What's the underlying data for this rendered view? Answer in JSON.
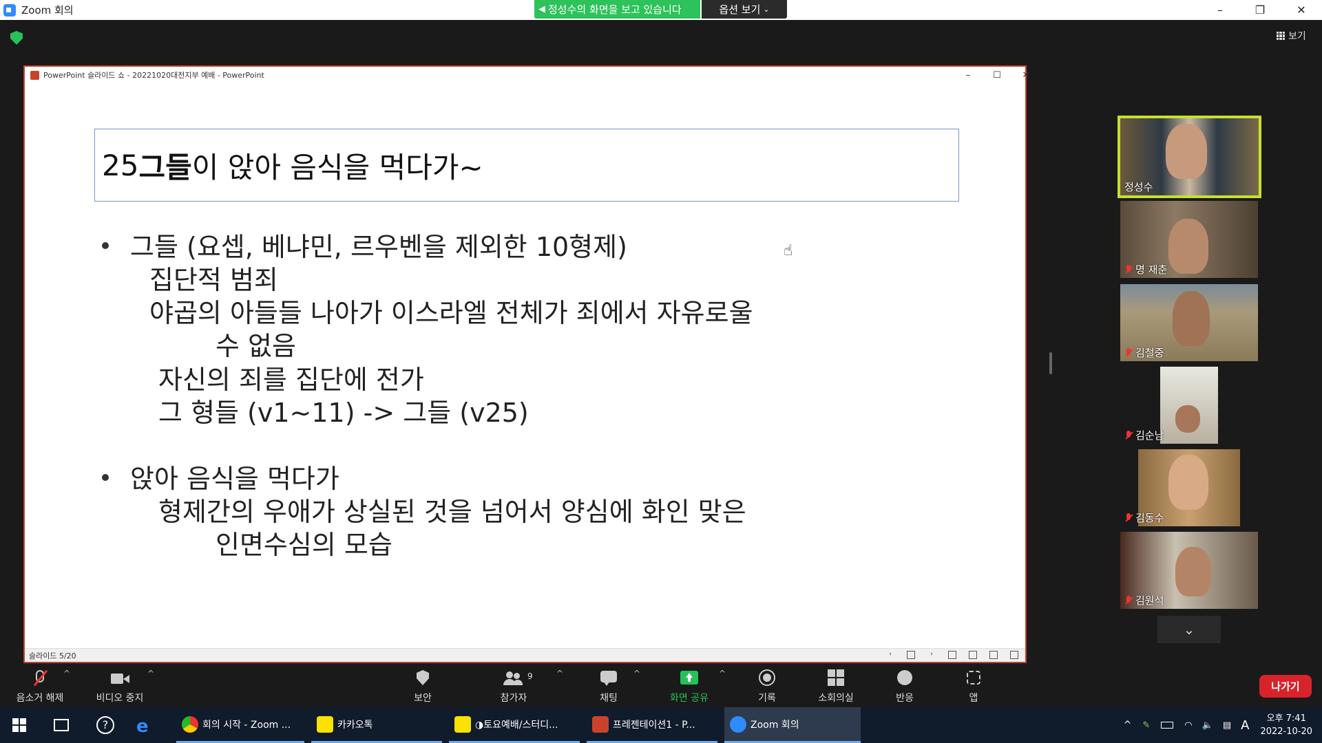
{
  "window": {
    "title": "Zoom 회의",
    "share_banner": "정성수의 화면을 보고 있습니다",
    "view_options": "옵션 보기",
    "view_button": "보기"
  },
  "powerpoint": {
    "window_title": "PowerPoint 슬라이드 쇼  -  20221020대전지부 예배 - PowerPoint",
    "slide_indicator": "슬라이드 5/20",
    "slide": {
      "title_number": "25 ",
      "title_bold": "그들",
      "title_rest": "이 앉아 음식을 먹다가~",
      "lines": [
        "그들 (요셉, 베냐민, 르우벤을 제외한 10형제)",
        "집단적 범죄",
        "야곱의 아들들 나아가 이스라엘 전체가 죄에서 자유로울",
        "수 없음",
        "자신의 죄를 집단에 전가",
        "그 형들 (v1~11) -> 그들 (v25)",
        "앉아 음식을 먹다가",
        "형제간의 우애가 상실된 것을 넘어서 양심에 화인 맞은",
        "인면수심의 모습"
      ]
    }
  },
  "participants": [
    {
      "name": "정성수",
      "muted": false,
      "active": true
    },
    {
      "name": "명 재춘",
      "muted": true
    },
    {
      "name": "김철중",
      "muted": true
    },
    {
      "name": "김순남",
      "muted": true
    },
    {
      "name": "김동수",
      "muted": true
    },
    {
      "name": "김원석",
      "muted": true
    }
  ],
  "toolbar": {
    "unmute": "음소거 해제",
    "stop_video": "비디오 중지",
    "security": "보안",
    "participants": "참가자",
    "participants_count": "9",
    "chat": "채팅",
    "share_screen": "화면 공유",
    "record": "기록",
    "breakout": "소회의실",
    "reactions": "반응",
    "apps": "앱",
    "leave": "나가기"
  },
  "taskbar": {
    "items": [
      {
        "label": "회의 시작 - Zoom ...",
        "icon": "chrome-icon"
      },
      {
        "label": "카카오톡",
        "icon": "kakaotalk-icon"
      },
      {
        "label": "◑토요예배/스터디...",
        "icon": "kakaotalk-icon"
      },
      {
        "label": "프레젠테이션1 - P...",
        "icon": "powerpoint-icon"
      },
      {
        "label": "Zoom 회의",
        "icon": "zoom-icon"
      }
    ],
    "time": "오후 7:41",
    "date": "2022-10-20",
    "ime": "A"
  },
  "colors": {
    "share_banner": "#2dc25a",
    "active_speaker": "#c7e02c",
    "leave": "#d8232a",
    "share_icon": "#27c05a"
  }
}
